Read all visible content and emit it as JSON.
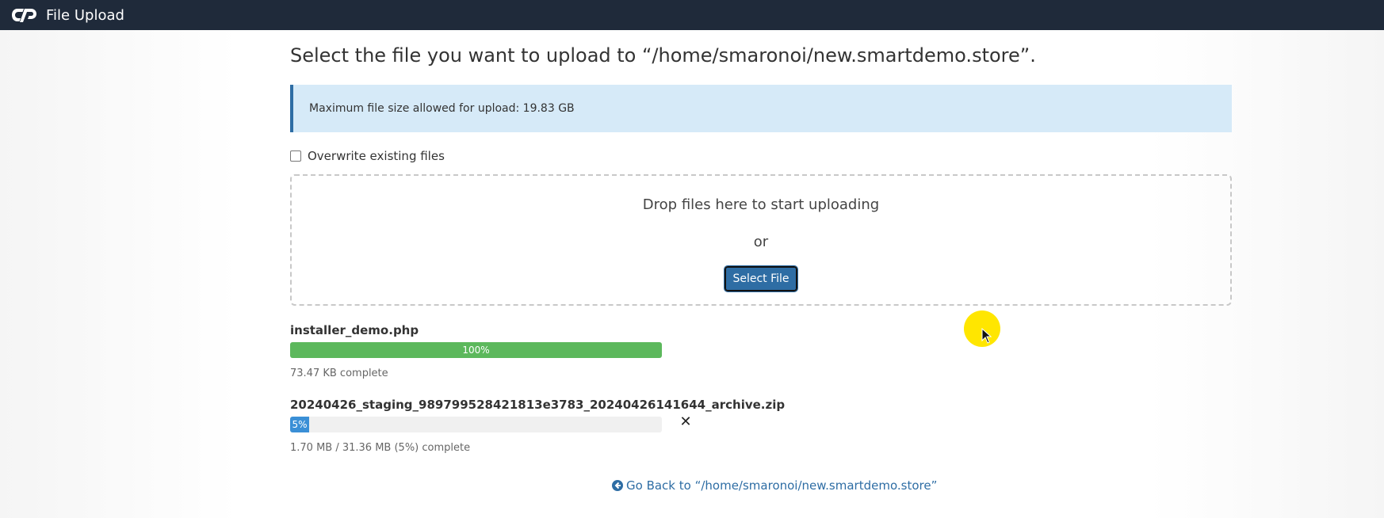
{
  "app": {
    "title": "File Upload",
    "logo_icon": "cpanel-logo-icon"
  },
  "page": {
    "heading": "Select the file you want to upload to “/home/smaronoi/new.smartdemo.store”.",
    "info": "Maximum file size allowed for upload: 19.83 GB",
    "overwrite_label": "Overwrite existing files",
    "overwrite_checked": false
  },
  "dropzone": {
    "prompt": "Drop files here to start uploading",
    "or": "or",
    "button_label": "Select File"
  },
  "uploads": [
    {
      "name": "installer_demo.php",
      "percent_label": "100%",
      "progress": 1.0,
      "status": "73.47 KB complete",
      "color": "#5cb85c"
    },
    {
      "name": "20240426_staging_989799528421813e3783_20240426141644_archive.zip",
      "percent_label": "5%",
      "progress": 0.05,
      "status": "1.70 MB / 31.36 MB (5%) complete",
      "color": "#3a8fd6",
      "cancel_icon": "close-icon",
      "cancel_symbol": "✕"
    }
  ],
  "footer": {
    "go_back": "Go Back to “/home/smaronoi/new.smartdemo.store”",
    "go_back_icon": "arrow-circle-left-icon"
  },
  "colors": {
    "topbar": "#1f2a3a",
    "accent": "#2e6da4",
    "info_bg": "#d6eaf8",
    "cursor_highlight": "#ffe600"
  }
}
